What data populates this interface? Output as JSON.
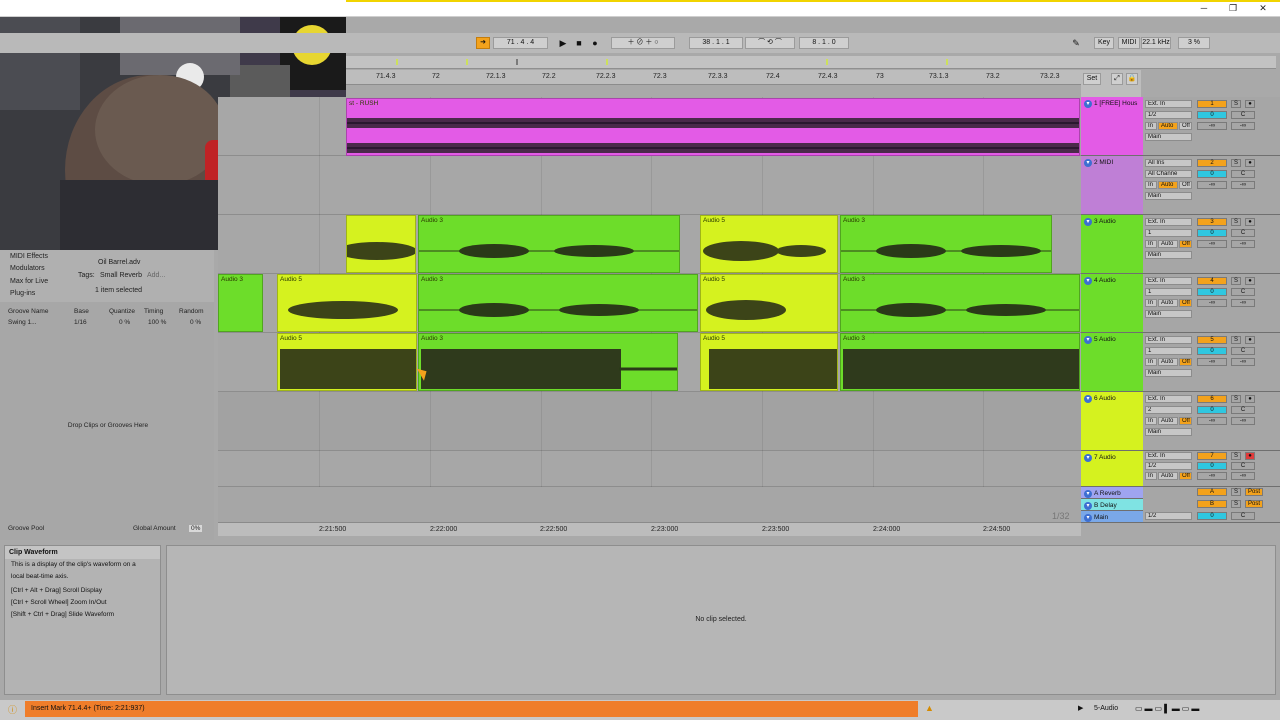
{
  "window": {
    "min_icon": "minimize-icon",
    "max_icon": "restore-icon",
    "close_icon": "close-icon",
    "min_glyph": "─",
    "max_glyph": "❐",
    "close_glyph": "✕"
  },
  "transport": {
    "arrangement_position": "71 .  4 .  4",
    "loop_start": "38 .  1 .  1",
    "loop_length": "8 .  1 .  0",
    "key_label": "Key",
    "midi_label": "MIDI",
    "sample_rate": "22.1 kHz",
    "cpu": "3 %"
  },
  "ruler": {
    "bars": [
      "71.4.3",
      "72",
      "72.1.3",
      "72.2",
      "72.2.3",
      "72.3",
      "72.3.3",
      "72.4",
      "72.4.3",
      "73",
      "73.1.3",
      "73.2",
      "73.2.3"
    ],
    "set_label": "Set"
  },
  "timeline": {
    "times": [
      "2:21:500",
      "2:22:000",
      "2:22:500",
      "2:23:000",
      "2:23:500",
      "2:24:000",
      "2:24:500"
    ],
    "zoom": "1/32"
  },
  "tracks": [
    {
      "name": "1 [FREE] Hous",
      "input": "Ext. In",
      "channel": "1/2",
      "output": "Main",
      "number": "1"
    },
    {
      "name": "2 MIDI",
      "input": "All Ins",
      "channel": "All Channe",
      "output": "Main",
      "number": "2"
    },
    {
      "name": "3 Audio",
      "input": "Ext. In",
      "channel": "1",
      "output": "Main",
      "number": "3"
    },
    {
      "name": "4 Audio",
      "input": "Ext. In",
      "channel": "1",
      "output": "Main",
      "number": "4"
    },
    {
      "name": "5 Audio",
      "input": "Ext. In",
      "channel": "1",
      "output": "Main",
      "number": "5"
    },
    {
      "name": "6 Audio",
      "input": "Ext. In",
      "channel": "2",
      "output": "Main",
      "number": "6"
    },
    {
      "name": "7 Audio",
      "input": "Ext. In",
      "channel": "1/2",
      "output": "Main",
      "number": "7"
    }
  ],
  "monitor": {
    "in": "In",
    "auto": "Auto",
    "off": "Off"
  },
  "mixer": {
    "solo": "S",
    "arm_c": "C",
    "vol": "0",
    "neg_inf": "-∞"
  },
  "returns": [
    {
      "name": "A Reverb",
      "letter": "A",
      "post": "Post"
    },
    {
      "name": "B Delay",
      "letter": "B",
      "post": "Post"
    },
    {
      "name": "Main",
      "letter": "0",
      "post": "",
      "channel": "1/2"
    }
  ],
  "clips": {
    "track1": "st - RUSH",
    "audio3": "Audio 3",
    "audio5": "Audio 5"
  },
  "browser": {
    "categories": [
      "MIDI Effects",
      "Modulators",
      "Max for Live",
      "Plug-ins"
    ],
    "file": "Oil Barrel.adv",
    "tags_label": "Tags:",
    "tag": "Small Reverb",
    "tag_add": "Add...",
    "selection": "1 item selected"
  },
  "groove": {
    "headers": [
      "Groove Name",
      "Base",
      "Quantize",
      "Timing",
      "Random"
    ],
    "row": [
      "Swing 1...",
      "1/16",
      "0 %",
      "100 %",
      "0 %"
    ],
    "drop_hint": "Drop Clips or Grooves Here",
    "pool_label": "Groove Pool",
    "global_amount_label": "Global Amount",
    "global_amount": "0%"
  },
  "info_view": {
    "title": "Clip Waveform",
    "lines": [
      "This is a display of the clip's waveform on a",
      "local beat-time axis.",
      "",
      "[Ctrl + Alt + Drag] Scroll Display",
      "[Ctrl + Scroll Wheel] Zoom In/Out",
      "[Shift + Ctrl + Drag] Slide Waveform"
    ]
  },
  "detail_view": {
    "message": "No clip selected."
  },
  "status": {
    "message": "Insert Mark 71.4.4+ (Time: 2:21:937)",
    "track": "5-Audio"
  },
  "colors": {
    "pink": "#e35be6",
    "lime": "#d5f21f",
    "green": "#6ddd2a",
    "orange": "#f3a21c",
    "status_orange": "#ef7d2a",
    "accent": "#f1d400"
  }
}
